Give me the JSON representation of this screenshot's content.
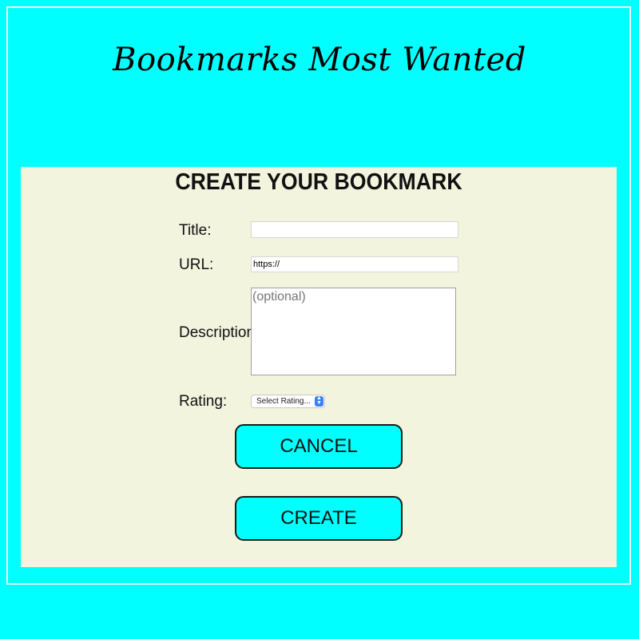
{
  "app": {
    "title": "Bookmarks Most Wanted"
  },
  "form": {
    "heading": "CREATE YOUR BOOKMARK",
    "title_label": "Title:",
    "title_value": "",
    "url_label": "URL:",
    "url_value": "https://",
    "description_label": "Description:",
    "description_placeholder": "(optional)",
    "rating_label": "Rating:",
    "rating_selected": "Select Rating...",
    "cancel_label": "CANCEL",
    "create_label": "CREATE"
  },
  "colors": {
    "background": "#00ffff",
    "panel": "#f3f4de",
    "button": "#00ffff",
    "select_arrow": "#3b82f6"
  },
  "icons": {
    "select_arrow": "chevron-up-down-icon"
  }
}
